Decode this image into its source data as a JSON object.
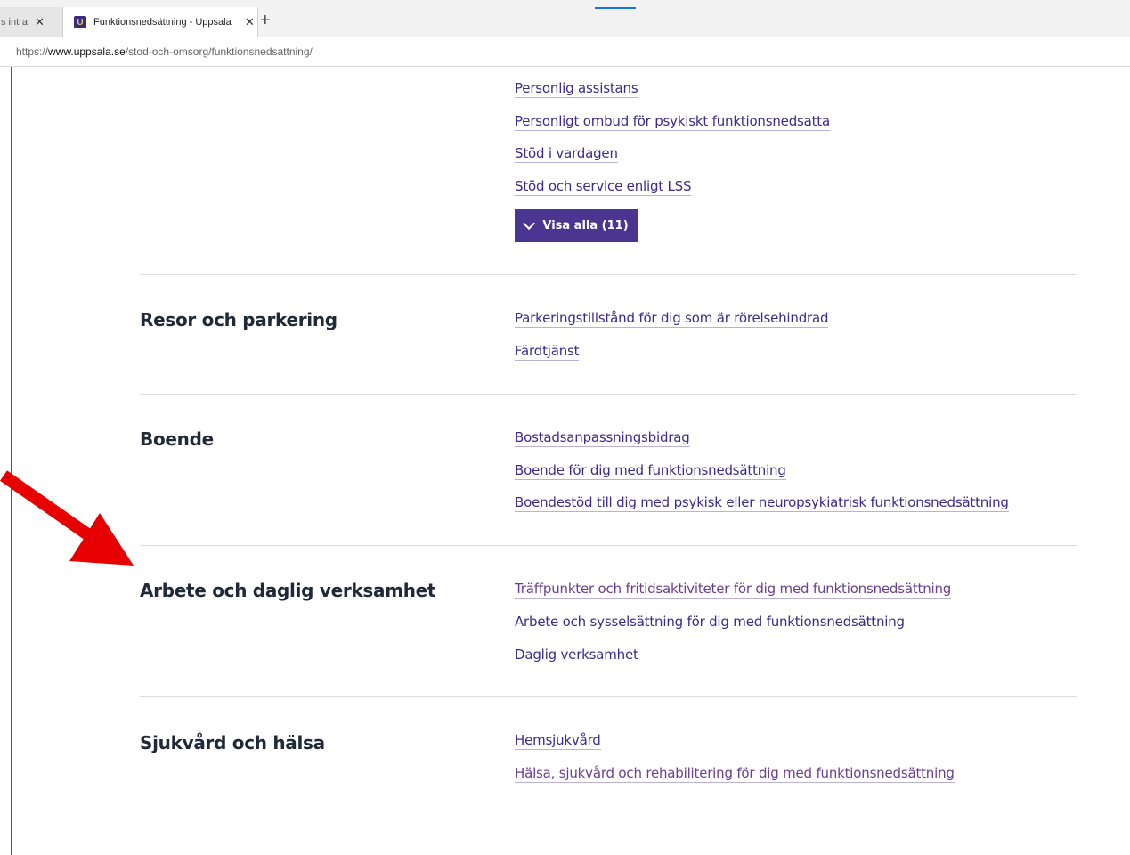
{
  "browser": {
    "tabs": [
      {
        "title": "s intra",
        "active": false
      },
      {
        "title": "Funktionsnedsättning - Uppsala",
        "active": true
      }
    ],
    "favicon_letter": "U",
    "url_prefix": "https://",
    "url_host": "www.uppsala.se",
    "url_path": "/stod-och-omsorg/funktionsnedsattning/"
  },
  "top_links": [
    "Personlig assistans",
    "Personligt ombud för psykiskt funktionsnedsatta",
    "Stöd i vardagen",
    "Stöd och service enligt LSS"
  ],
  "show_all_label": "Visa alla (11)",
  "sections": [
    {
      "title": "Resor och parkering",
      "links": [
        "Parkeringstillstånd för dig som är rörelsehindrad",
        "Färdtjänst"
      ]
    },
    {
      "title": "Boende",
      "links": [
        "Bostadsanpassningsbidrag",
        "Boende för dig med funktionsnedsättning",
        "Boendestöd till dig med psykisk eller neuropsykiatrisk funktionsnedsättning"
      ]
    },
    {
      "title": "Arbete och daglig verksamhet",
      "links": [
        "Träffpunkter och fritidsaktiviteter för dig med funktionsnedsättning",
        "Arbete och sysselsättning för dig med funktionsnedsättning",
        "Daglig verksamhet"
      ]
    },
    {
      "title": "Sjukvård och hälsa",
      "links": [
        "Hemsjukvård",
        "Hälsa, sjukvård och rehabilitering för dig med funktionsnedsättning"
      ]
    }
  ],
  "colors": {
    "accent": "#4a3590",
    "link": "#3d2a8c",
    "annotation": "#e60000"
  },
  "icons": {
    "annotation_arrow": "red-arrow-icon"
  }
}
